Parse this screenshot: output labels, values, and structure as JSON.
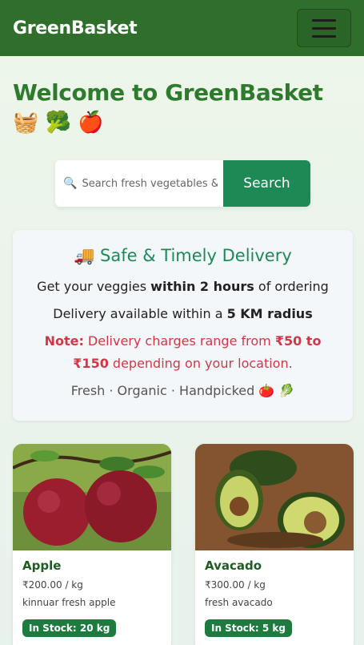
{
  "navbar": {
    "brand": "GreenBasket",
    "menu_icon": "hamburger-icon"
  },
  "welcome": {
    "title": "Welcome to GreenBasket",
    "emoji": "🧺 🥦 🍎"
  },
  "search": {
    "placeholder": "Search fresh vegetables & fruits",
    "button_label": "Search"
  },
  "delivery": {
    "icon": "🚚",
    "title": "Safe & Timely Delivery",
    "line1_pre": "Get your veggies ",
    "line1_bold": "within 2 hours",
    "line1_post": " of ordering",
    "line2_pre": "Delivery available within a ",
    "line2_bold": "5 KM radius",
    "note_label": "Note:",
    "note_pre": " Delivery charges range from ",
    "note_bold": "₹50 to ₹150",
    "note_post": " depending on your location.",
    "tagline": "Fresh · Organic · Handpicked 🍅 🥬"
  },
  "products": [
    {
      "name": "Apple",
      "price": "₹200.00 / kg",
      "description": "kinnuar fresh apple",
      "stock": "In Stock: 20 kg"
    },
    {
      "name": "Avacado",
      "price": "₹300.00 / kg",
      "description": "fresh avacado",
      "stock": "In Stock: 5 kg"
    }
  ],
  "colors": {
    "nav": "#2f6f2b",
    "accent": "#1d8a55",
    "note": "#d23745"
  }
}
